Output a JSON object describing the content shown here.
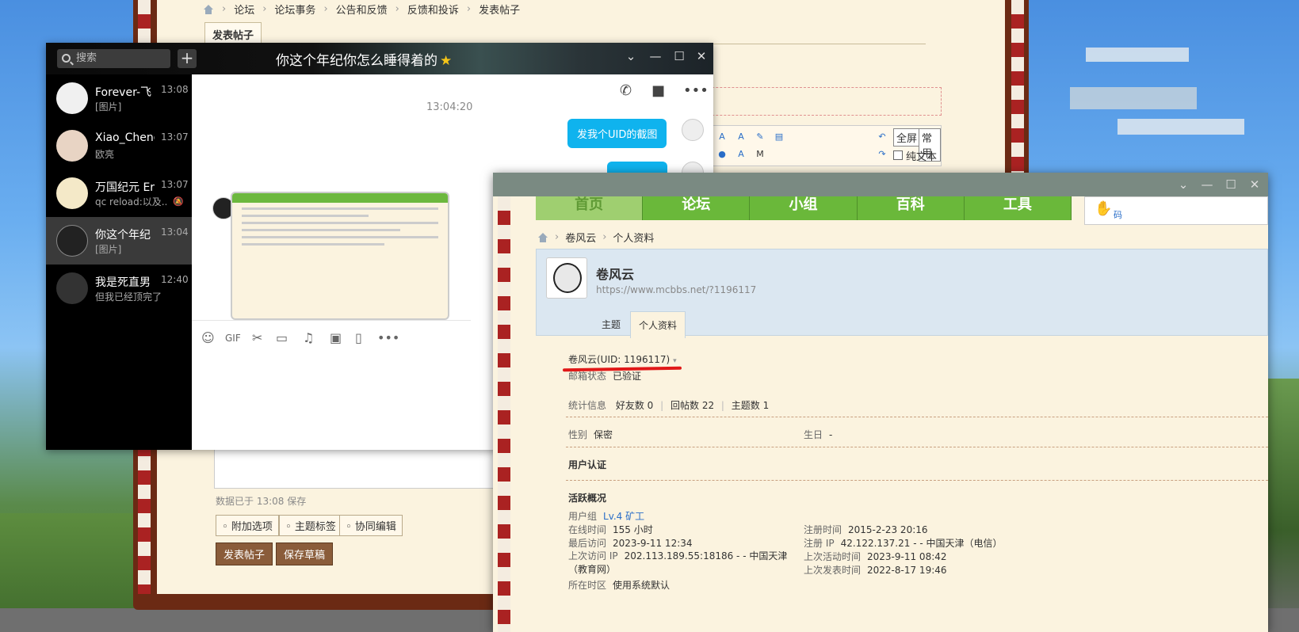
{
  "forum": {
    "breadcrumb": [
      "论坛",
      "论坛事务",
      "公告和反馈",
      "反馈和投诉",
      "发表帖子"
    ],
    "post_tab": "发表帖子",
    "toolbar_fullscreen": "全屏",
    "toolbar_common": "常用",
    "toolbar_plaintext": "纯文本",
    "draft_status": "数据已于 13:08 保存",
    "option_buttons": [
      "附加选项",
      "主题标签",
      "协同编辑"
    ],
    "submit_button": "发表帖子",
    "save_draft_button": "保存草稿"
  },
  "chat": {
    "search_placeholder": "搜索",
    "add_label": "+",
    "title": "你这个年纪你怎么睡得着的",
    "conversations": [
      {
        "name": "Forever-飞",
        "time": "13:08",
        "message": "[图片]"
      },
      {
        "name": "Xiao_Cheng",
        "time": "13:07",
        "message": "欧亮"
      },
      {
        "name": "万国纪元 Er",
        "time": "13:07",
        "message": "qc reload:以及..."
      },
      {
        "name": "你这个年纪",
        "time": "13:04",
        "message": "[图片]"
      },
      {
        "name": "我是死直男",
        "time": "12:40",
        "message": "但我已经顶完了"
      }
    ],
    "timestamp": "13:04:20",
    "bubble_text": "发我个UID的截图"
  },
  "profile": {
    "nav": [
      "首页",
      "论坛",
      "小组",
      "百科",
      "工具"
    ],
    "qr_label": "码",
    "breadcrumb": [
      "卷风云",
      "个人资料"
    ],
    "name": "卷风云",
    "url": "https://www.mcbbs.net/?1196117",
    "tabs": [
      "主题",
      "个人资料"
    ],
    "uid_line": "卷风云(UID: 1196117)",
    "email_label": "邮箱状态",
    "email_value": "已验证",
    "stats_label": "统计信息",
    "stats": [
      "好友数 0",
      "回帖数 22",
      "主题数 1"
    ],
    "gender_label": "性别",
    "gender_value": "保密",
    "birthday_label": "生日",
    "birthday_value": "-",
    "cert_title": "用户认证",
    "activity_title": "活跃概况",
    "usergroup_label": "用户组",
    "usergroup_value": "Lv.4 矿工",
    "online_label": "在线时间",
    "online_value": "155 小时",
    "register_label": "注册时间",
    "register_value": "2015-2-23 20:16",
    "last_visit_label": "最后访问",
    "last_visit_value": "2023-9-11 12:34",
    "reg_ip_label": "注册 IP",
    "reg_ip_value": "42.122.137.21 - - 中国天津（电信）",
    "last_ip_label": "上次访问 IP",
    "last_ip_value": "202.113.189.55:18186 - - 中国天津（教育网）",
    "last_active_label": "上次活动时间",
    "last_active_value": "2023-9-11 08:42",
    "last_post_label": "上次发表时间",
    "last_post_value": "2022-8-17 19:46",
    "timezone_label": "所在时区",
    "timezone_value": "使用系统默认"
  }
}
